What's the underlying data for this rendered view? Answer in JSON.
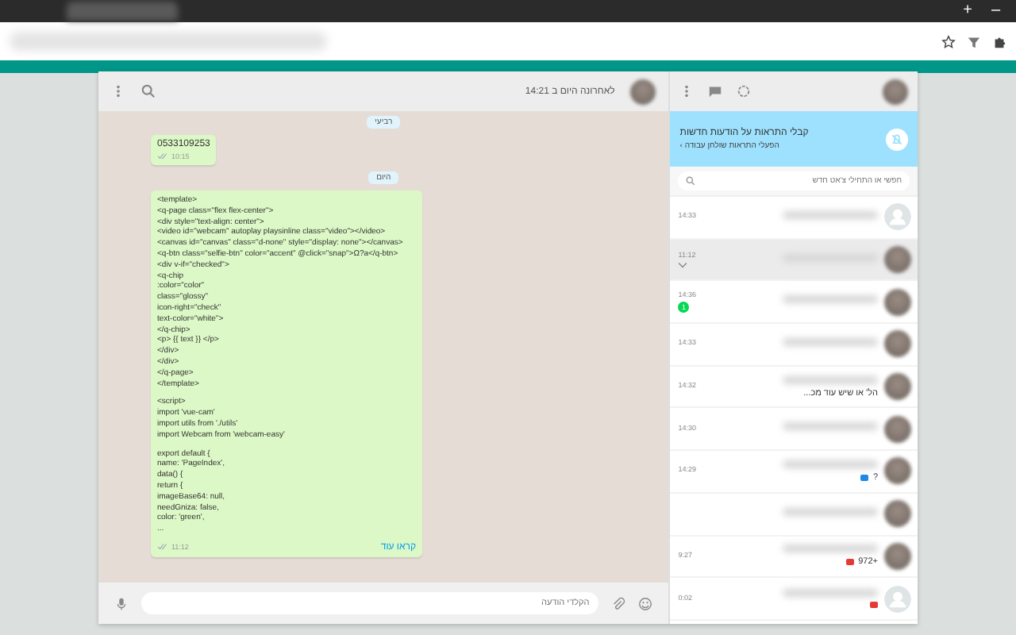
{
  "browser": {
    "new_tab": "+",
    "minimize": "–"
  },
  "chat": {
    "status": "לאחרונה היום ב 14:21",
    "messages": [
      {
        "kind": "date",
        "text": "רביעי"
      },
      {
        "kind": "text",
        "text": "0533109253",
        "time": "10:15"
      },
      {
        "kind": "date",
        "text": "היום"
      },
      {
        "kind": "code",
        "time": "11:12",
        "more": "קראו עוד",
        "blocks": [
          [
            "<template>",
            "<q-page class=\"flex flex-center\">",
            "<div style=\"text-align: center\">",
            "<video id=\"webcam\" autoplay playsinline class=\"video\"></video>",
            "<canvas id=\"canvas\" class=\"d-none\" style=\"display: none\"></canvas>",
            "<q-btn class=\"selfie-btn\" color=\"accent\" @click=\"snap\">Ω?a</q-btn>",
            "<div v-if=\"checked\">",
            "<q-chip",
            ":color=\"color\"",
            "class=\"glossy\"",
            "icon-right=\"check\"",
            "text-color=\"white\">",
            "</q-chip>",
            "<p> {{ text }} </p>",
            "</div>",
            "</div>",
            "</q-page>",
            "</template>"
          ],
          [
            "<script>",
            "import 'vue-cam'",
            "import utils from './utils'",
            "import Webcam from 'webcam-easy'"
          ],
          [
            "export default {",
            "name: 'PageIndex',",
            "data() {",
            "return {",
            "imageBase64: null,",
            "needGniza: false,",
            "color: 'green',",
            "..."
          ]
        ]
      }
    ],
    "composer": {
      "placeholder": "הקלדי הודעה"
    }
  },
  "sidebar": {
    "notice": {
      "title": "קבלי התראות על הודעות חדשות",
      "link": "הפעלי התראות שולחן עבודה ›"
    },
    "search": {
      "placeholder": "חפשי או התחילי צ'אט חדש"
    },
    "chats": [
      {
        "time": "14:33",
        "selected": false,
        "kind": "default"
      },
      {
        "time": "11:12",
        "selected": true,
        "kind": "photo",
        "menu": true
      },
      {
        "time": "14:36",
        "selected": false,
        "kind": "photo",
        "unread": "1"
      },
      {
        "time": "14:33",
        "selected": false,
        "kind": "photo"
      },
      {
        "time": "14:32",
        "selected": false,
        "kind": "photo",
        "preview": "הל' או שיש עוד מכ..."
      },
      {
        "time": "14:30",
        "selected": false,
        "kind": "photo"
      },
      {
        "time": "14:29",
        "selected": false,
        "kind": "photo",
        "preview": "?",
        "color": "#1e88e5"
      },
      {
        "selected": false,
        "kind": "photo"
      },
      {
        "time": "9:27",
        "selected": false,
        "kind": "photo",
        "preview": "+972",
        "color": "#e53935"
      },
      {
        "time": "0:02",
        "selected": false,
        "kind": "default",
        "color": "#e53935"
      }
    ]
  }
}
